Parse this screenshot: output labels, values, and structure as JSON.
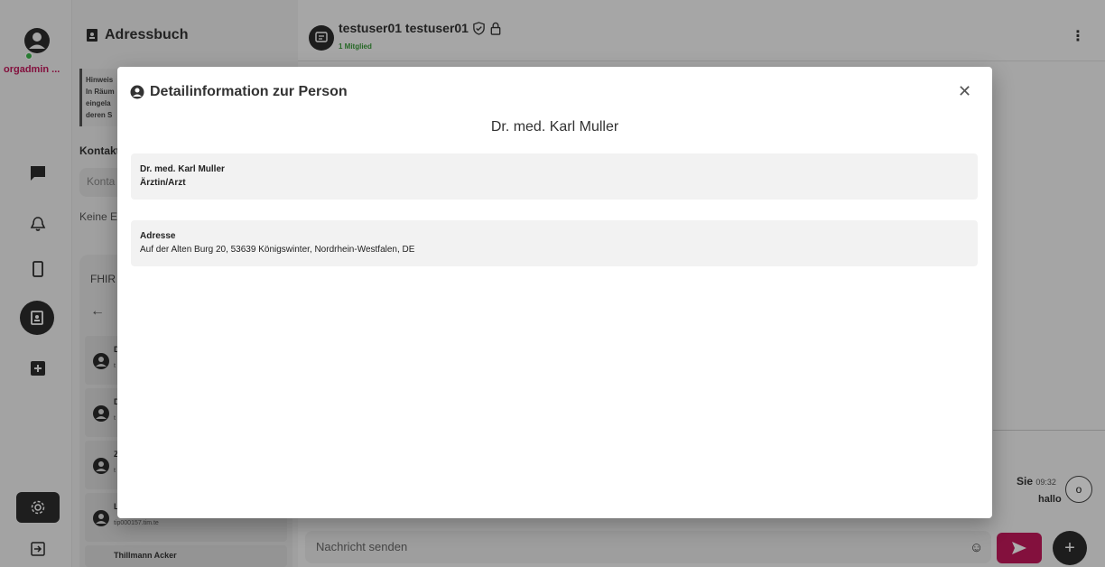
{
  "rail": {
    "user_label": "orgadmin ..."
  },
  "addressbook": {
    "title": "Adressbuch",
    "hint_lines": [
      "Hinweis",
      "In Räum",
      "eingela",
      "deren S"
    ],
    "contacts_heading": "Kontakt",
    "search_placeholder": "Konta",
    "empty_text": "Keine E",
    "fhir_title": "FHIR",
    "rows": [
      {
        "name": "D",
        "sub": "t"
      },
      {
        "name": "D",
        "sub": "t"
      },
      {
        "name": "Z",
        "sub": "t"
      },
      {
        "name": "L",
        "sub": "tip000157.tim.te"
      },
      {
        "name": "Thillmann Acker",
        "sub": ""
      }
    ]
  },
  "chat": {
    "room_name": "testuser01 testuser01",
    "members": "1 Mitglied",
    "message": {
      "sender": "Sie",
      "time": "09:32",
      "text": "hallo",
      "avatar_letter": "o"
    },
    "composer_placeholder": "Nachricht senden"
  },
  "modal": {
    "title": "Detailinformation zur Person",
    "person_name": "Dr. med. Karl Muller",
    "card1": {
      "name": "Dr. med. Karl Muller",
      "role": "Ärztin/Arzt"
    },
    "card2": {
      "label": "Adresse",
      "address": "Auf der Alten Burg 20, 53639 Königswinter, Nordrhein-Westfalen, DE"
    }
  },
  "colors": {
    "accent": "#c2185b",
    "online": "#3bb54a",
    "members": "#3a9a3a"
  }
}
